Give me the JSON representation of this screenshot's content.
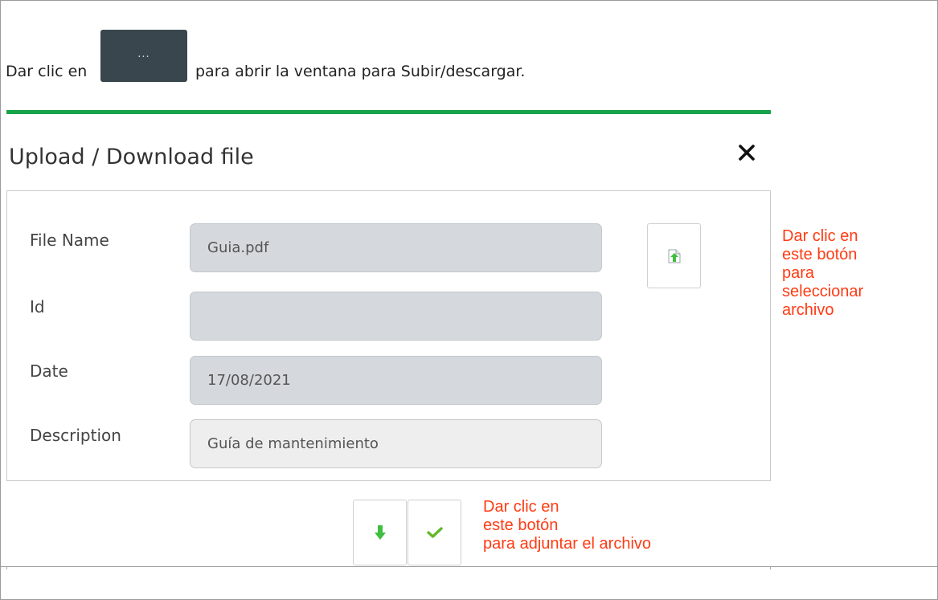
{
  "instruction": {
    "before_button": "Dar clic en",
    "button_label": "...",
    "after_button": "para abrir la ventana para Subir/descargar."
  },
  "modal": {
    "title": "Upload / Download file",
    "close_glyph": "✕",
    "fields": [
      {
        "label": "File Name",
        "value": "Guia.pdf"
      },
      {
        "label": "Id",
        "value": ""
      },
      {
        "label": "Date",
        "value": "17/08/2021"
      },
      {
        "label": "Description",
        "value": "Guía de mantenimiento"
      }
    ]
  },
  "annotations": {
    "select_file": [
      "Dar clic en",
      "este botón",
      "para",
      "seleccionar",
      "archivo"
    ],
    "attach_file": [
      "Dar clic en",
      "este botón",
      "para adjuntar el archivo"
    ]
  },
  "colors": {
    "accent_rule": "#16a34a",
    "annotation": "#ff3b14",
    "icon_green": "#3fbf3f",
    "dark_button": "#3a464d"
  },
  "icons": {
    "upload": "file-upload-icon",
    "download": "download-arrow-icon",
    "confirm": "checkmark-icon",
    "close": "close-icon"
  }
}
